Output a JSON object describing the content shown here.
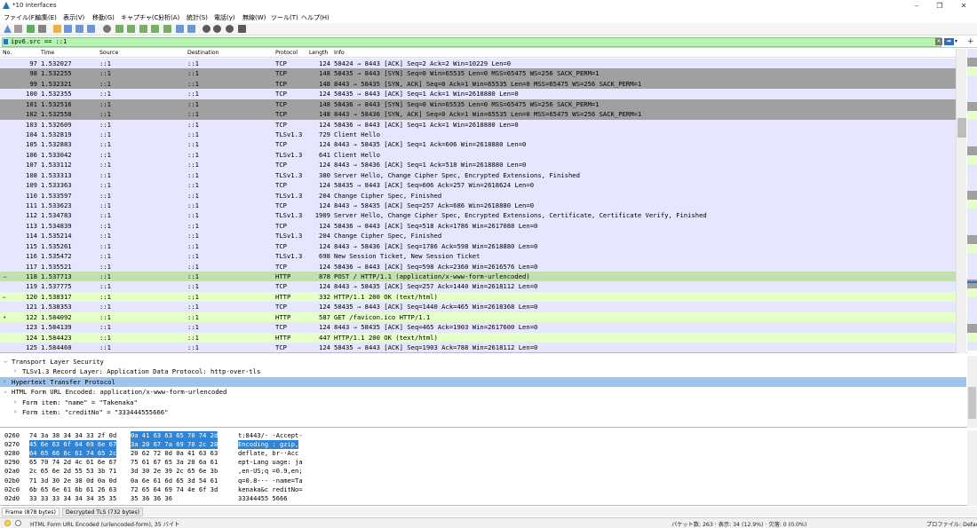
{
  "window": {
    "title": "*10 interfaces",
    "minimize": "–",
    "maximize": "❐",
    "close": "✕"
  },
  "menu": [
    "ファイル(F)",
    "編集(E)",
    "表示(V)",
    "移動(G)",
    "キャプチャ(C)",
    "分析(A)",
    "統計(S)",
    "電話(y)",
    "無線(W)",
    "ツール(T)",
    "ヘルプ(H)"
  ],
  "toolbar": {
    "icons": [
      "shark-fin-icon",
      "stop-icon",
      "restart-icon",
      "options-gear-icon",
      "open-folder-icon",
      "save-file-icon",
      "close-file-icon",
      "reload-icon",
      "find-icon",
      "back-icon",
      "forward-icon",
      "goto-packet-icon",
      "first-packet-icon",
      "last-packet-icon",
      "autoscroll-icon",
      "colorize-icon",
      "zoom-in-icon",
      "zoom-out-icon",
      "zoom-normal-icon",
      "resize-columns-icon"
    ],
    "colors": [
      "#3a78c8",
      "#888888",
      "#3c9a3c",
      "#666666",
      "#e0a020",
      "#4a7fc9",
      "#4a7fc9",
      "#4a7fc9",
      "#555555",
      "#5a9a40",
      "#5a9a40",
      "#5a9a40",
      "#5a9a40",
      "#5a9a40",
      "#4a7fc9",
      "#4a7fc9",
      "#333333",
      "#333333",
      "#333333",
      "#333333"
    ]
  },
  "filter": {
    "value": "ipv6.src == ::1",
    "clear": "✕",
    "apply": "➡",
    "dropdown": "▾",
    "add": "+"
  },
  "colors": {
    "tcp": "#e7e6ff",
    "syn": "#a0a0a0",
    "http": "#e4ffc7",
    "selected": "#c3dfae",
    "tree_highlight": "#9fc4ee",
    "hex_selection": "#2f84d6",
    "filter_bg": "#b7f3b3"
  },
  "packet_list": {
    "columns": [
      "No.",
      "Time",
      "Source",
      "Destination",
      "Protocol",
      "Length",
      "Info"
    ],
    "rows": [
      {
        "no": "97",
        "time": "1.532027",
        "src": "::1",
        "dst": "::1",
        "proto": "TCP",
        "len": "124",
        "info": "58424 → 8443 [ACK] Seq=2 Ack=2 Win=10229 Len=0",
        "cls": "c-tcp",
        "mark": ""
      },
      {
        "no": "98",
        "time": "1.532255",
        "src": "::1",
        "dst": "::1",
        "proto": "TCP",
        "len": "148",
        "info": "58435 → 8443 [SYN] Seq=0 Win=65535 Len=0 MSS=65475 WS=256 SACK_PERM=1",
        "cls": "c-syn",
        "mark": ""
      },
      {
        "no": "99",
        "time": "1.532321",
        "src": "::1",
        "dst": "::1",
        "proto": "TCP",
        "len": "148",
        "info": "8443 → 58435 [SYN, ACK] Seq=0 Ack=1 Win=65535 Len=0 MSS=65475 WS=256 SACK_PERM=1",
        "cls": "c-syn",
        "mark": ""
      },
      {
        "no": "100",
        "time": "1.532355",
        "src": "::1",
        "dst": "::1",
        "proto": "TCP",
        "len": "124",
        "info": "58435 → 8443 [ACK] Seq=1 Ack=1 Win=2618880 Len=0",
        "cls": "c-tcp",
        "mark": ""
      },
      {
        "no": "101",
        "time": "1.532516",
        "src": "::1",
        "dst": "::1",
        "proto": "TCP",
        "len": "148",
        "info": "58436 → 8443 [SYN] Seq=0 Win=65535 Len=0 MSS=65475 WS=256 SACK_PERM=1",
        "cls": "c-syn",
        "mark": ""
      },
      {
        "no": "102",
        "time": "1.532558",
        "src": "::1",
        "dst": "::1",
        "proto": "TCP",
        "len": "148",
        "info": "8443 → 58436 [SYN, ACK] Seq=0 Ack=1 Win=65535 Len=0 MSS=65475 WS=256 SACK_PERM=1",
        "cls": "c-syn",
        "mark": ""
      },
      {
        "no": "103",
        "time": "1.532609",
        "src": "::1",
        "dst": "::1",
        "proto": "TCP",
        "len": "124",
        "info": "58436 → 8443 [ACK] Seq=1 Ack=1 Win=2618880 Len=0",
        "cls": "c-tcp",
        "mark": ""
      },
      {
        "no": "104",
        "time": "1.532819",
        "src": "::1",
        "dst": "::1",
        "proto": "TLSv1.3",
        "len": "729",
        "info": "Client Hello",
        "cls": "c-tcp",
        "mark": ""
      },
      {
        "no": "105",
        "time": "1.532883",
        "src": "::1",
        "dst": "::1",
        "proto": "TCP",
        "len": "124",
        "info": "8443 → 58435 [ACK] Seq=1 Ack=606 Win=2618880 Len=0",
        "cls": "c-tcp",
        "mark": ""
      },
      {
        "no": "106",
        "time": "1.533042",
        "src": "::1",
        "dst": "::1",
        "proto": "TLSv1.3",
        "len": "641",
        "info": "Client Hello",
        "cls": "c-tcp",
        "mark": ""
      },
      {
        "no": "107",
        "time": "1.533112",
        "src": "::1",
        "dst": "::1",
        "proto": "TCP",
        "len": "124",
        "info": "8443 → 58436 [ACK] Seq=1 Ack=518 Win=2618880 Len=0",
        "cls": "c-tcp",
        "mark": ""
      },
      {
        "no": "108",
        "time": "1.533313",
        "src": "::1",
        "dst": "::1",
        "proto": "TLSv1.3",
        "len": "380",
        "info": "Server Hello, Change Cipher Spec, Encrypted Extensions, Finished",
        "cls": "c-tcp",
        "mark": ""
      },
      {
        "no": "109",
        "time": "1.533363",
        "src": "::1",
        "dst": "::1",
        "proto": "TCP",
        "len": "124",
        "info": "58435 → 8443 [ACK] Seq=606 Ack=257 Win=2618624 Len=0",
        "cls": "c-tcp",
        "mark": ""
      },
      {
        "no": "110",
        "time": "1.533597",
        "src": "::1",
        "dst": "::1",
        "proto": "TLSv1.3",
        "len": "204",
        "info": "Change Cipher Spec, Finished",
        "cls": "c-tcp",
        "mark": ""
      },
      {
        "no": "111",
        "time": "1.533623",
        "src": "::1",
        "dst": "::1",
        "proto": "TCP",
        "len": "124",
        "info": "8443 → 58435 [ACK] Seq=257 Ack=686 Win=2618880 Len=0",
        "cls": "c-tcp",
        "mark": ""
      },
      {
        "no": "112",
        "time": "1.534783",
        "src": "::1",
        "dst": "::1",
        "proto": "TLSv1.3",
        "len": "1909",
        "info": "Server Hello, Change Cipher Spec, Encrypted Extensions, Certificate, Certificate Verify, Finished",
        "cls": "c-tcp",
        "mark": ""
      },
      {
        "no": "113",
        "time": "1.534839",
        "src": "::1",
        "dst": "::1",
        "proto": "TCP",
        "len": "124",
        "info": "58436 → 8443 [ACK] Seq=518 Ack=1786 Win=2617088 Len=0",
        "cls": "c-tcp",
        "mark": ""
      },
      {
        "no": "114",
        "time": "1.535214",
        "src": "::1",
        "dst": "::1",
        "proto": "TLSv1.3",
        "len": "204",
        "info": "Change Cipher Spec, Finished",
        "cls": "c-tcp",
        "mark": ""
      },
      {
        "no": "115",
        "time": "1.535261",
        "src": "::1",
        "dst": "::1",
        "proto": "TCP",
        "len": "124",
        "info": "8443 → 58436 [ACK] Seq=1786 Ack=598 Win=2618880 Len=0",
        "cls": "c-tcp",
        "mark": ""
      },
      {
        "no": "116",
        "time": "1.535472",
        "src": "::1",
        "dst": "::1",
        "proto": "TLSv1.3",
        "len": "698",
        "info": "New Session Ticket, New Session Ticket",
        "cls": "c-tcp",
        "mark": ""
      },
      {
        "no": "117",
        "time": "1.535521",
        "src": "::1",
        "dst": "::1",
        "proto": "TCP",
        "len": "124",
        "info": "58436 → 8443 [ACK] Seq=598 Ack=2360 Win=2616576 Len=0",
        "cls": "c-tcp",
        "mark": ""
      },
      {
        "no": "118",
        "time": "1.537713",
        "src": "::1",
        "dst": "::1",
        "proto": "HTTP",
        "len": "878",
        "info": "POST / HTTP/1.1  (application/x-www-form-urlencoded)",
        "cls": "c-sel",
        "mark": "→"
      },
      {
        "no": "119",
        "time": "1.537775",
        "src": "::1",
        "dst": "::1",
        "proto": "TCP",
        "len": "124",
        "info": "8443 → 58435 [ACK] Seq=257 Ack=1440 Win=2618112 Len=0",
        "cls": "c-tcp",
        "mark": ""
      },
      {
        "no": "120",
        "time": "1.538317",
        "src": "::1",
        "dst": "::1",
        "proto": "HTTP",
        "len": "332",
        "info": "HTTP/1.1 200 OK  (text/html)",
        "cls": "c-http",
        "mark": "←"
      },
      {
        "no": "121",
        "time": "1.538353",
        "src": "::1",
        "dst": "::1",
        "proto": "TCP",
        "len": "124",
        "info": "58435 → 8443 [ACK] Seq=1440 Ack=465 Win=2618368 Len=0",
        "cls": "c-tcp",
        "mark": ""
      },
      {
        "no": "122",
        "time": "1.584092",
        "src": "::1",
        "dst": "::1",
        "proto": "HTTP",
        "len": "587",
        "info": "GET /favicon.ico HTTP/1.1",
        "cls": "c-http",
        "mark": "•"
      },
      {
        "no": "123",
        "time": "1.584139",
        "src": "::1",
        "dst": "::1",
        "proto": "TCP",
        "len": "124",
        "info": "8443 → 58435 [ACK] Seq=465 Ack=1903 Win=2617600 Len=0",
        "cls": "c-tcp",
        "mark": ""
      },
      {
        "no": "124",
        "time": "1.584423",
        "src": "::1",
        "dst": "::1",
        "proto": "HTTP",
        "len": "447",
        "info": "HTTP/1.1 200 OK  (text/html)",
        "cls": "c-http",
        "mark": ""
      },
      {
        "no": "125",
        "time": "1.584460",
        "src": "::1",
        "dst": "::1",
        "proto": "TCP",
        "len": "124",
        "info": "58435 → 8443 [ACK] Seq=1903 Ack=788 Win=2618112 Len=0",
        "cls": "c-tcp",
        "mark": ""
      }
    ]
  },
  "details": [
    {
      "arrow": "›",
      "text": "Transport Layer Security",
      "indent": 0,
      "hl": false,
      "expanded": true
    },
    {
      "arrow": "›",
      "text": "TLSv1.3 Record Layer: Application Data Protocol: http-over-tls",
      "indent": 1,
      "hl": false,
      "expanded": false
    },
    {
      "arrow": "›",
      "text": "Hypertext Transfer Protocol",
      "indent": 0,
      "hl": true,
      "expanded": false
    },
    {
      "arrow": "›",
      "text": "HTML Form URL Encoded: application/x-www-form-urlencoded",
      "indent": 0,
      "hl": false,
      "expanded": true
    },
    {
      "arrow": "›",
      "text": "Form item: \"name\" = \"Takenaka\"",
      "indent": 1,
      "hl": false,
      "expanded": false
    },
    {
      "arrow": "›",
      "text": "Form item: \"creditNo\" = \"333444555666\"",
      "indent": 1,
      "hl": false,
      "expanded": false
    }
  ],
  "bytes": [
    {
      "off": "0260",
      "hex1": "74 3a 38 34 34 33 2f 0d",
      "hex2": "0a 41 63 63 65 70 74 2d",
      "ascii": "t:8443/· ·Accept-",
      "sel": "after-0a"
    },
    {
      "off": "0270",
      "hex1": "45 6e 63 6f 64 69 6e 67",
      "hex2": "3a 20 67 7a 69 70 2c 20",
      "ascii": "Encoding : gzip, ",
      "sel": "all"
    },
    {
      "off": "0280",
      "hex1": "64 65 66 6c 61 74 65 2c",
      "hex2": "20 62 72 0d 0a 41 63 63",
      "ascii": "deflate,  br··Acc",
      "sel": "upto-0a"
    },
    {
      "off": "0290",
      "hex1": "65 70 74 2d 4c 61 6e 67",
      "hex2": "75 61 67 65 3a 20 6a 61",
      "ascii": "ept-Lang uage: ja",
      "sel": "none"
    },
    {
      "off": "02a0",
      "hex1": "2c 65 6e 2d 55 53 3b 71",
      "hex2": "3d 30 2e 39 2c 65 6e 3b",
      "ascii": ",en-US;q =0.9,en;",
      "sel": "none"
    },
    {
      "off": "02b0",
      "hex1": "71 3d 30 2e 38 0d 0a 0d",
      "hex2": "0a 6e 61 6d 65 3d 54 61",
      "ascii": "q=0.8··· ·name=Ta",
      "sel": "none"
    },
    {
      "off": "02c0",
      "hex1": "6b 65 6e 61 6b 61 26 63",
      "hex2": "72 65 64 69 74 4e 6f 3d",
      "ascii": "kenaka&c reditNo=",
      "sel": "none"
    },
    {
      "off": "02d0",
      "hex1": "33 33 33 34 34 34 35 35",
      "hex2": "35 36 36 36",
      "ascii": "33344455 5666",
      "sel": "none"
    }
  ],
  "byte_tabs": [
    "Frame (878 bytes)",
    "Decrypted TLS (732 bytes)"
  ],
  "status": {
    "left": "HTML Form URL Encoded (urlencoded-form), 35 バイト",
    "packets": "パケット数: 263 · 表示: 34 (12.9%) · 欠落: 0 (0.0%)",
    "profile": "プロファイル: Default"
  }
}
